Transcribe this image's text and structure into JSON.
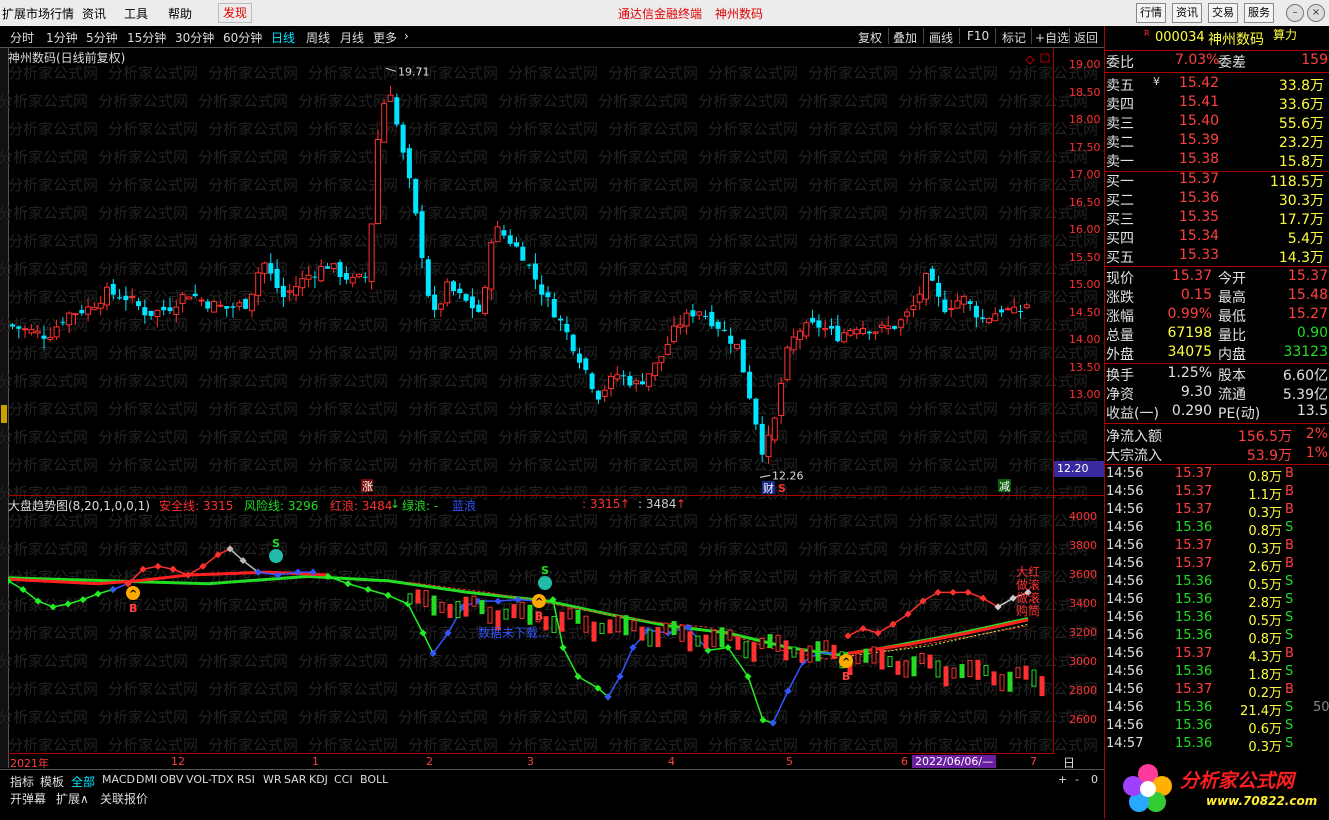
{
  "menu": {
    "items": [
      "扩展市场行情",
      "资讯",
      "工具",
      "帮助"
    ],
    "discover": "发现",
    "center_title_1": "通达信金融终端",
    "center_title_2": "神州数码",
    "right_buttons": [
      "行情",
      "资讯",
      "交易",
      "服务"
    ]
  },
  "period_bar": {
    "periods": [
      "分时",
      "1分钟",
      "5分钟",
      "15分钟",
      "30分钟",
      "60分钟",
      "日线",
      "周线",
      "月线",
      "更多"
    ],
    "active": "日线",
    "tools": [
      "复权",
      "叠加",
      "画线",
      "F10",
      "标记",
      "+自选",
      "返回"
    ]
  },
  "main_chart": {
    "title": "神州数码(日线前复权)",
    "watermark": "分析家公式网",
    "high_label": "19.71",
    "low_label": "12.26",
    "price_axis": [
      "19.00",
      "18.50",
      "18.00",
      "17.50",
      "17.00",
      "16.50",
      "16.00",
      "15.50",
      "15.00",
      "14.50",
      "14.00",
      "13.50",
      "13.00"
    ],
    "cursor_price": "12.20",
    "markers": {
      "zhang": "涨",
      "cai": "财",
      "s": "S",
      "jian": "减"
    }
  },
  "indicator": {
    "name": "大盘趋势图(8,20,1,0,0,1)",
    "safe_line": "安全线: 3315",
    "risk_line": "风险线: 3296",
    "red_wave": "红浪: 3484",
    "green_wave": "绿浪: -",
    "blue_wave": "蓝浪",
    "v1": ": 3315",
    "v2": ": 3484",
    "axis": [
      "4000",
      "3800",
      "3600",
      "3400",
      "3200",
      "3000",
      "2800",
      "2600"
    ],
    "note": "数据未下载...",
    "right_text": [
      "大红",
      "做滚",
      "做滚",
      "购筒"
    ]
  },
  "date_axis": {
    "labels": [
      "2021年",
      "12",
      "1",
      "2",
      "3",
      "4",
      "5",
      "6",
      "7"
    ],
    "cursor_date": "2022/06/06/—",
    "period_label": "日线"
  },
  "bottom_tabs": [
    "指标",
    "模板",
    "全部",
    "MACD",
    "DMI",
    "OBV",
    "VOL-TDX",
    "RSI",
    "WR",
    "SAR",
    "KDJ",
    "CCI",
    "BOLL"
  ],
  "bottom_tabs_active": "全部",
  "bottom_row2": [
    "开弹幕",
    "扩展∧",
    "关联报价"
  ],
  "bottom_controls": [
    "+",
    "-",
    "0"
  ],
  "quote": {
    "r_badge": "R",
    "code": "000034",
    "name": "神州数码",
    "suan": "算力",
    "weibi_label": "委比",
    "weibi": "7.03%",
    "weicha_label": "委差",
    "weicha": "159",
    "asks": [
      {
        "label": "卖五",
        "price": "15.42",
        "vol": "33.8万"
      },
      {
        "label": "卖四",
        "price": "15.41",
        "vol": "33.6万"
      },
      {
        "label": "卖三",
        "price": "15.40",
        "vol": "55.6万"
      },
      {
        "label": "卖二",
        "price": "15.39",
        "vol": "23.2万"
      },
      {
        "label": "卖一",
        "price": "15.38",
        "vol": "15.8万"
      }
    ],
    "bids": [
      {
        "label": "买一",
        "price": "15.37",
        "vol": "118.5万"
      },
      {
        "label": "买二",
        "price": "15.36",
        "vol": "30.3万"
      },
      {
        "label": "买三",
        "price": "15.35",
        "vol": "17.7万"
      },
      {
        "label": "买四",
        "price": "15.34",
        "vol": "5.4万"
      },
      {
        "label": "买五",
        "price": "15.33",
        "vol": "14.3万"
      }
    ],
    "stats": [
      {
        "l1": "现价",
        "v1": "15.37",
        "l2": "今开",
        "v2": "15.37"
      },
      {
        "l1": "涨跌",
        "v1": "0.15",
        "l2": "最高",
        "v2": "15.48"
      },
      {
        "l1": "涨幅",
        "v1": "0.99%",
        "l2": "最低",
        "v2": "15.27"
      },
      {
        "l1": "总量",
        "v1": "67198",
        "l2": "量比",
        "v2": "0.90"
      },
      {
        "l1": "外盘",
        "v1": "34075",
        "l2": "内盘",
        "v2": "33123"
      }
    ],
    "stats2": [
      {
        "l1": "换手",
        "v1": "1.25%",
        "l2": "股本",
        "v2": "6.60亿"
      },
      {
        "l1": "净资",
        "v1": "9.30",
        "l2": "流通",
        "v2": "5.39亿"
      },
      {
        "l1": "收益(一)",
        "v1": "0.290",
        "l2": "PE(动)",
        "v2": "13.5"
      }
    ],
    "flows": [
      {
        "label": "净流入额",
        "value": "156.5万",
        "pct": "2%"
      },
      {
        "label": "大宗流入",
        "value": "53.9万",
        "pct": "1%"
      }
    ],
    "ticks": [
      {
        "t": "14:56",
        "p": "15.37",
        "v": "0.8万",
        "bs": "B"
      },
      {
        "t": "14:56",
        "p": "15.37",
        "v": "1.1万",
        "bs": "B"
      },
      {
        "t": "14:56",
        "p": "15.37",
        "v": "0.3万",
        "bs": "B"
      },
      {
        "t": "14:56",
        "p": "15.36",
        "v": "0.8万",
        "bs": "S"
      },
      {
        "t": "14:56",
        "p": "15.37",
        "v": "0.3万",
        "bs": "B"
      },
      {
        "t": "14:56",
        "p": "15.37",
        "v": "2.6万",
        "bs": "B"
      },
      {
        "t": "14:56",
        "p": "15.36",
        "v": "0.5万",
        "bs": "S"
      },
      {
        "t": "14:56",
        "p": "15.36",
        "v": "2.8万",
        "bs": "S"
      },
      {
        "t": "14:56",
        "p": "15.36",
        "v": "0.5万",
        "bs": "S"
      },
      {
        "t": "14:56",
        "p": "15.36",
        "v": "0.8万",
        "bs": "S"
      },
      {
        "t": "14:56",
        "p": "15.37",
        "v": "4.3万",
        "bs": "B"
      },
      {
        "t": "14:56",
        "p": "15.36",
        "v": "1.8万",
        "bs": "S"
      },
      {
        "t": "14:56",
        "p": "15.37",
        "v": "0.2万",
        "bs": "B"
      },
      {
        "t": "14:56",
        "p": "15.36",
        "v": "21.4万",
        "bs": "S",
        "x": "50"
      },
      {
        "t": "14:56",
        "p": "15.36",
        "v": "0.6万",
        "bs": "S"
      },
      {
        "t": "14:57",
        "p": "15.36",
        "v": "0.3万",
        "bs": "S"
      }
    ]
  },
  "logo": {
    "name": "分析家公式网",
    "url": "www.70822.com"
  },
  "colors": {
    "up": "#ff3030",
    "down": "#00ffff",
    "green": "#22dd22",
    "blue": "#2244ff",
    "yellow": "#ffff40",
    "axis_red": "#a00000"
  }
}
